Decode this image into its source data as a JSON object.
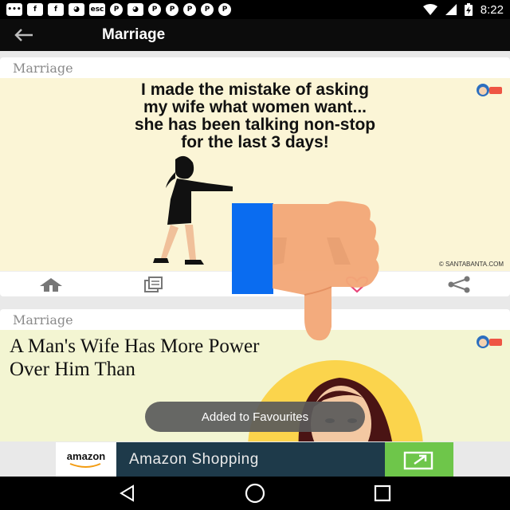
{
  "status_bar": {
    "time": "8:22",
    "notification_icons": [
      "chat-icon",
      "facebook-icon",
      "facebook-icon",
      "cat-icon",
      "esc-icon",
      "pinterest-icon",
      "cat-icon",
      "pinterest-icon",
      "pinterest-icon",
      "pinterest-icon",
      "pinterest-icon",
      "pinterest-icon"
    ],
    "esc_label": "esc"
  },
  "app_bar": {
    "title": "Marriage",
    "back_icon": "arrow-left-icon"
  },
  "cards": [
    {
      "category": "Marriage",
      "joke_lines": [
        "I made the mistake of asking",
        "my wife what women want...",
        "she has been talking non-stop",
        "for the last 3 days!"
      ],
      "brand": "© SANTABANTA.COM",
      "favourited": true
    },
    {
      "category": "Marriage",
      "joke_lines": [
        "A Man's Wife Has More Power",
        "Over Him Than"
      ]
    }
  ],
  "actions": [
    "home-icon",
    "copy-icon",
    "whatsapp-icon",
    "heart-icon",
    "share-icon"
  ],
  "toast": {
    "message": "Added to Favourites"
  },
  "ad": {
    "logo_text": "amazon",
    "title": "Amazon Shopping"
  },
  "colors": {
    "accent_heart": "#e8457a",
    "overlay_blue": "#0a6cf0",
    "thumb_skin": "#f3a878",
    "ad_cta": "#6ec64a"
  }
}
